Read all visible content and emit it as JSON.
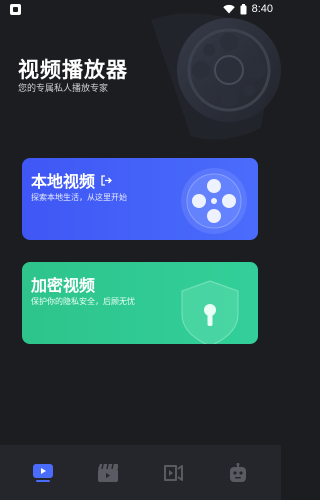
{
  "status_bar": {
    "time": "8:40"
  },
  "header": {
    "title": "视频播放器",
    "subtitle": "您的专属私人播放专家"
  },
  "cards": {
    "local": {
      "title": "本地视频",
      "description": "探索本地生活，从这里开始"
    },
    "secret": {
      "title": "加密视频",
      "description": "保护你的隐私安全，后顾无忧"
    }
  },
  "bottom_nav": {
    "items": [
      {
        "icon": "play-video-icon",
        "active": true
      },
      {
        "icon": "clapperboard-icon",
        "active": false
      },
      {
        "icon": "video-share-icon",
        "active": false
      },
      {
        "icon": "robot-icon",
        "active": false
      }
    ]
  },
  "colors": {
    "background": "#1c1d21",
    "local_card": "#4a6cfb",
    "secret_card": "#33cf9a",
    "nav_active": "#4a6cfb",
    "nav_inactive": "#5a5b62"
  }
}
